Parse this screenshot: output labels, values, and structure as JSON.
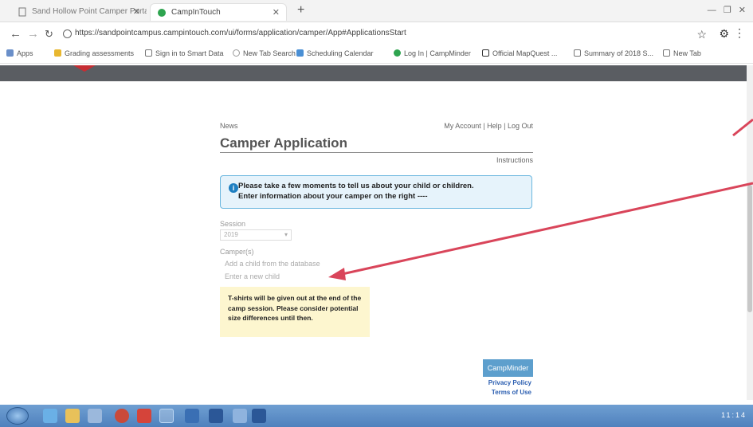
{
  "browser": {
    "tabs": [
      {
        "title": "Sand Hollow Point Camper Portal",
        "active": false
      },
      {
        "title": "CampInTouch",
        "active": true
      }
    ],
    "url": "https://sandpointcampus.campintouch.com/ui/forms/application/camper/App#ApplicationsStart",
    "bookmarks": [
      {
        "label": "Apps"
      },
      {
        "label": "Grading assessments"
      },
      {
        "label": "Sign in to Smart Data"
      },
      {
        "label": "New Tab Search"
      },
      {
        "label": "Scheduling Calendar"
      },
      {
        "label": "Log In | CampMinder"
      },
      {
        "label": "Official MapQuest ..."
      },
      {
        "label": "Summary of 2018 S..."
      },
      {
        "label": "New Tab"
      }
    ]
  },
  "page": {
    "news_link": "News",
    "account_links": "My Account | Help | Log Out",
    "title": "Camper Application",
    "instructions_link": "Instructions",
    "info_message_line1": "Please take a few moments to tell us about your child or children.",
    "info_message_line2": "Enter information about your camper on the right ----",
    "session_label": "Session",
    "session_value": "2019",
    "campers_label": "Camper(s)",
    "camper_link_1": "Add a child from the database",
    "camper_link_2": "Enter a new child",
    "note_text": "T-shirts will be given out at the end of the camp session. Please consider potential size differences until then.",
    "footer_logo": "CampMinder",
    "privacy_link": "Privacy Policy",
    "terms_link": "Terms of Use"
  },
  "colors": {
    "info_border": "#6bb7df",
    "info_bg": "#e6f3fb",
    "note_bg": "#fdf6cf",
    "arrow": "#d9455a",
    "site_bar": "#5a5d62",
    "taskbar": "#4f81bd"
  },
  "taskbar": {
    "tray_text": "11:14"
  }
}
